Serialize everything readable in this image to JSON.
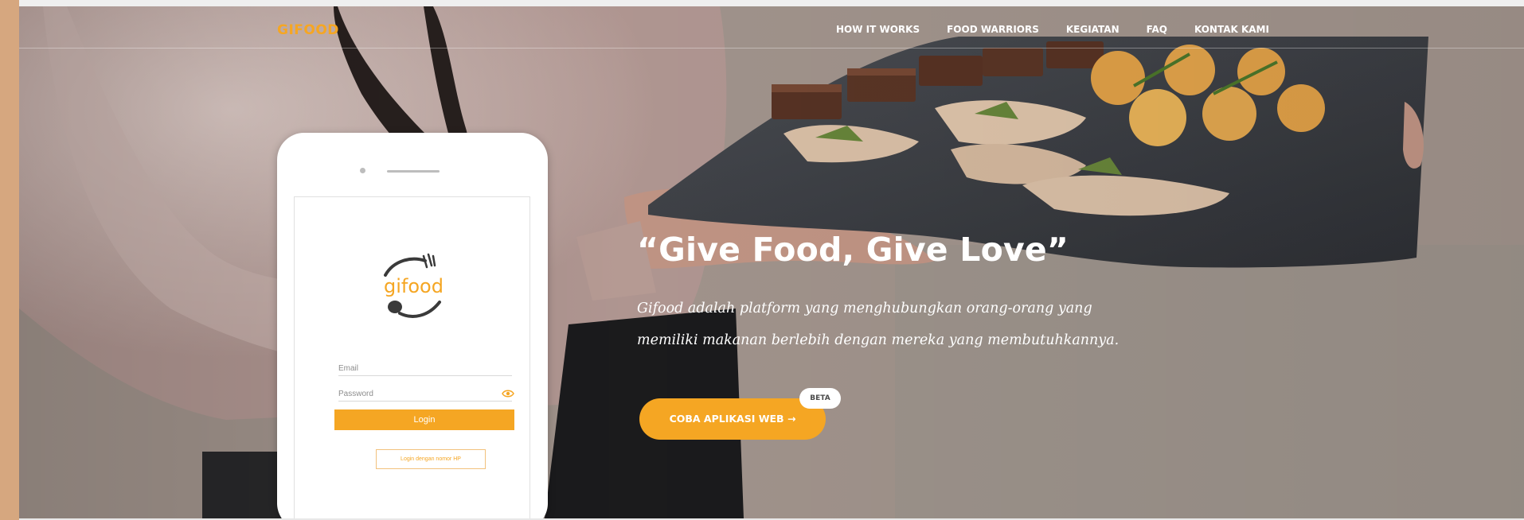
{
  "header": {
    "logo": "GIFOOD",
    "nav": [
      "HOW IT WORKS",
      "FOOD WARRIORS",
      "KEGIATAN",
      "FAQ",
      "KONTAK KAMI"
    ]
  },
  "hero": {
    "headline": "“Give Food, Give Love”",
    "subtext_line1": "Gifood adalah platform yang menghubungkan orang-orang yang",
    "subtext_line2": "memiliki makanan berlebih dengan mereka yang membutuhkannya.",
    "cta_label": "COBA APLIKASI WEB →",
    "badge": "BETA"
  },
  "phone": {
    "app_logo_text": "gifood",
    "email_label": "Email",
    "password_label": "Password",
    "login_label": "Login",
    "otp_label": "Login dengan nomor HP"
  },
  "colors": {
    "accent": "#f5a623",
    "sidebar_strip": "#d6a77f",
    "text_light": "#ffffff"
  },
  "icons": [
    "fork-icon",
    "spoon-icon",
    "eye-icon",
    "arrow-right-icon"
  ]
}
